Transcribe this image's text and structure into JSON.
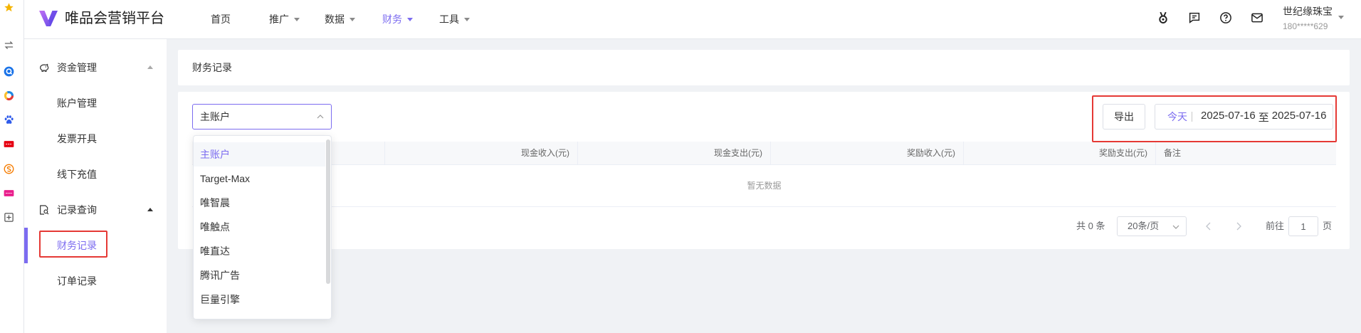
{
  "colors": {
    "brand": "#7c6cf0",
    "highlight_box": "#e53935",
    "page_bg": "#f0f2f5"
  },
  "left_strip": {
    "icons": [
      "star-icon",
      "swap-icon",
      "q-app-icon",
      "colorful-circle-app-icon",
      "paw-app-icon",
      "red-badge-app-icon",
      "orange-s-app-icon",
      "pink-app-icon",
      "add-square-icon"
    ]
  },
  "app": {
    "logo_icon": "vip-v-logo-icon",
    "logo_text": "唯品会营销平台"
  },
  "nav": {
    "items": [
      {
        "label": "首页",
        "dropdown": false,
        "active": false
      },
      {
        "label": "推广",
        "dropdown": true,
        "active": false
      },
      {
        "label": "数据",
        "dropdown": true,
        "active": false
      },
      {
        "label": "财务",
        "dropdown": true,
        "active": true
      },
      {
        "label": "工具",
        "dropdown": true,
        "active": false
      }
    ]
  },
  "header_icons": [
    "medal-icon",
    "message-icon",
    "help-icon",
    "mail-icon"
  ],
  "user": {
    "name": "世纪缘珠宝",
    "phone": "180*****629"
  },
  "sidebar": {
    "groups": [
      {
        "label": "资金管理",
        "icon": "piggy-bank-icon",
        "expanded": true,
        "items": [
          {
            "label": "账户管理"
          },
          {
            "label": "发票开具"
          },
          {
            "label": "线下充值"
          }
        ]
      },
      {
        "label": "记录查询",
        "icon": "record-search-icon",
        "expanded": true,
        "items": [
          {
            "label": "财务记录",
            "active": true,
            "highlighted": true
          },
          {
            "label": "订单记录"
          }
        ]
      }
    ]
  },
  "page": {
    "title": "财务记录"
  },
  "filters": {
    "account_select": {
      "value": "主账户",
      "open": true,
      "options": [
        "主账户",
        "Target-Max",
        "唯智晨",
        "唯触点",
        "唯直达",
        "腾讯广告",
        "巨量引擎"
      ]
    },
    "export_label": "导出",
    "date_range": {
      "quick": "今天",
      "start": "2025-07-16",
      "separator": "至",
      "end": "2025-07-16",
      "highlighted": true
    }
  },
  "table": {
    "columns": [
      "",
      "现金收入(元)",
      "现金支出(元)",
      "奖励收入(元)",
      "奖励支出(元)",
      "备注"
    ],
    "rows": [],
    "empty_text": "暂无数据"
  },
  "pagination": {
    "total_text": "共 0 条",
    "page_size": "20条/页",
    "goto_label": "前往",
    "current_page": "1",
    "page_suffix": "页",
    "prev_disabled": true,
    "next_disabled": true
  }
}
